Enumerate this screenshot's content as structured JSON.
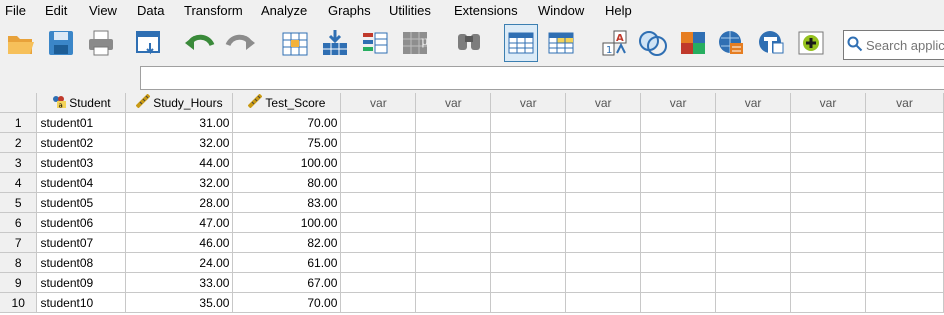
{
  "menu": [
    "File",
    "Edit",
    "View",
    "Data",
    "Transform",
    "Analyze",
    "Graphs",
    "Utilities",
    "Extensions",
    "Window",
    "Help"
  ],
  "toolbar": {
    "icons": [
      "open-folder-icon",
      "save-icon",
      "print-icon",
      "recall-dialog-icon",
      "undo-icon",
      "redo-icon",
      "goto-case-icon",
      "goto-variable-icon",
      "variables-icon",
      "run-descriptives-icon",
      "find-icon",
      "data-view-icon",
      "variable-view-icon",
      "value-labels-icon",
      "venn-icon",
      "color-squares-icon",
      "spell-icon",
      "split-file-icon",
      "add-extension-icon"
    ],
    "search_placeholder": "Search applic"
  },
  "grid": {
    "columns": [
      {
        "name": "Student",
        "type": "string"
      },
      {
        "name": "Study_Hours",
        "type": "scale"
      },
      {
        "name": "Test_Score",
        "type": "scale"
      },
      {
        "name": "var",
        "type": "empty"
      },
      {
        "name": "var",
        "type": "empty"
      },
      {
        "name": "var",
        "type": "empty"
      },
      {
        "name": "var",
        "type": "empty"
      },
      {
        "name": "var",
        "type": "empty"
      },
      {
        "name": "var",
        "type": "empty"
      },
      {
        "name": "var",
        "type": "empty"
      },
      {
        "name": "var",
        "type": "empty"
      }
    ],
    "rows": [
      {
        "n": "1",
        "student": "student01",
        "hours": "31.00",
        "score": "70.00"
      },
      {
        "n": "2",
        "student": "student02",
        "hours": "32.00",
        "score": "75.00"
      },
      {
        "n": "3",
        "student": "student03",
        "hours": "44.00",
        "score": "100.00"
      },
      {
        "n": "4",
        "student": "student04",
        "hours": "32.00",
        "score": "80.00"
      },
      {
        "n": "5",
        "student": "student05",
        "hours": "28.00",
        "score": "83.00"
      },
      {
        "n": "6",
        "student": "student06",
        "hours": "47.00",
        "score": "100.00"
      },
      {
        "n": "7",
        "student": "student07",
        "hours": "46.00",
        "score": "82.00"
      },
      {
        "n": "8",
        "student": "student08",
        "hours": "24.00",
        "score": "61.00"
      },
      {
        "n": "9",
        "student": "student09",
        "hours": "33.00",
        "score": "67.00"
      },
      {
        "n": "10",
        "student": "student10",
        "hours": "35.00",
        "score": "70.00"
      }
    ]
  }
}
